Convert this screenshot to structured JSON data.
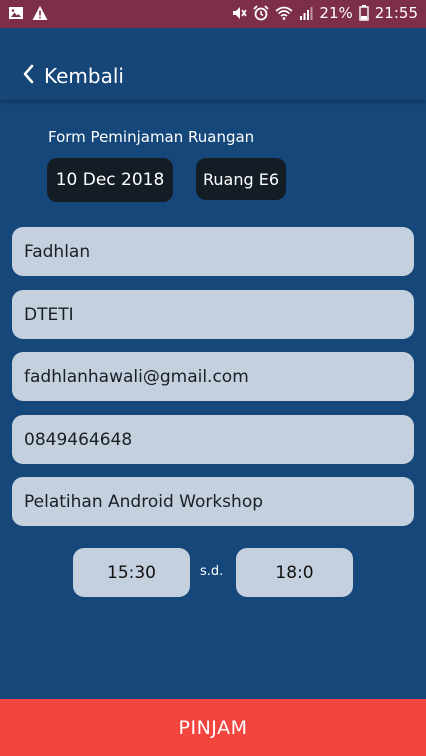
{
  "status_bar": {
    "battery": "21%",
    "time": "21:55",
    "icons": [
      "image-icon",
      "warning-icon",
      "mute-icon",
      "alarm-icon",
      "wifi-icon",
      "signal-icon",
      "battery-icon"
    ],
    "background": "#7d2f48"
  },
  "header": {
    "back_label": "Kembali",
    "back_icon": "chevron-left-icon"
  },
  "form": {
    "title": "Form Peminjaman Ruangan",
    "date": "10 Dec 2018",
    "room": "Ruang E6",
    "fields": {
      "name": "Fadhlan",
      "department": "DTETI",
      "email": "fadhlanhawali@gmail.com",
      "phone": "0849464648",
      "activity": "Pelatihan Android Workshop"
    },
    "time_start": "15:30",
    "time_separator": "s.d.",
    "time_end": "18:0"
  },
  "actions": {
    "submit_label": "PINJAM"
  },
  "colors": {
    "background": "#15477a",
    "field": "#c5d0de",
    "chip": "#141c26",
    "submit": "#f2453d"
  }
}
